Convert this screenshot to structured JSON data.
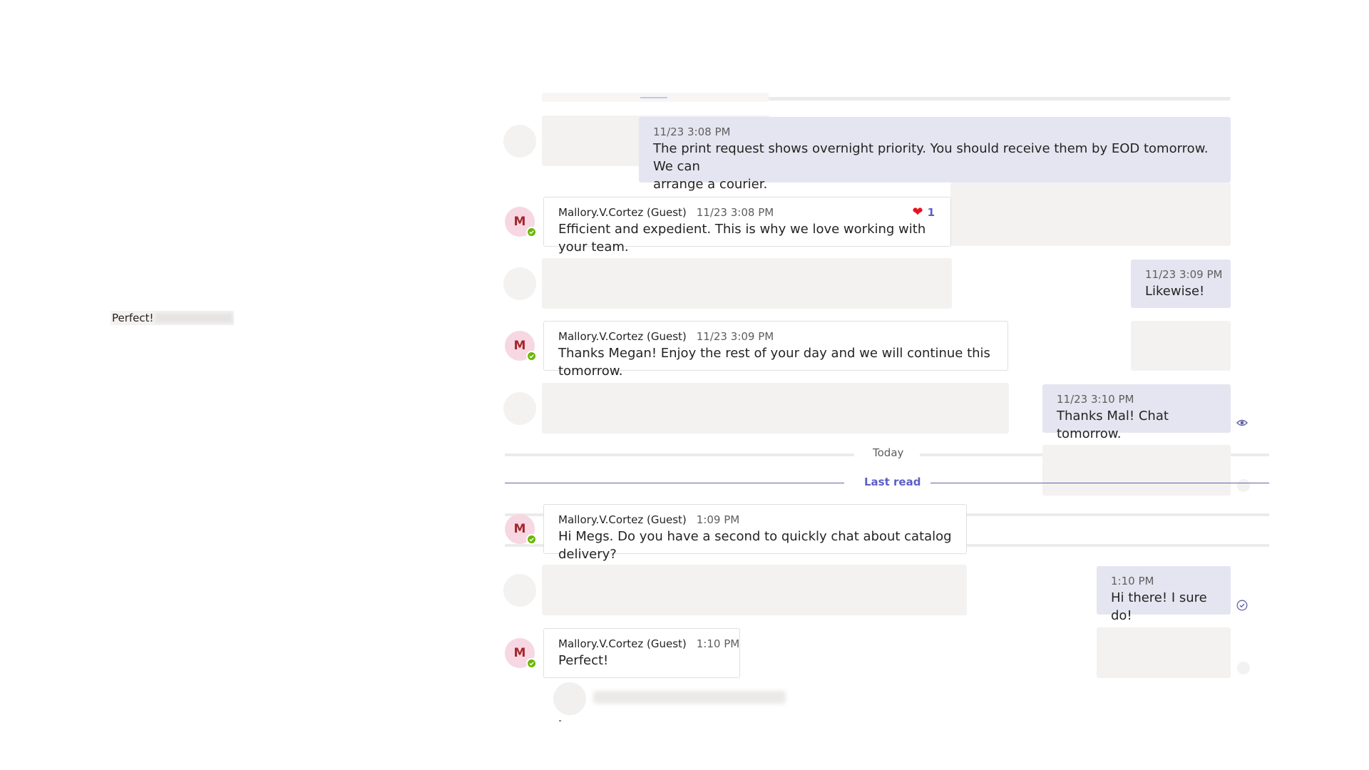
{
  "left_panel": {
    "preview_text": "Perfect!"
  },
  "messages": [
    {
      "direction": "outgoing",
      "timestamp": "11/23 3:08 PM",
      "text_line1": "The print request shows overnight priority. You should receive them by EOD tomorrow. We can",
      "text_line2": "arrange a courier."
    },
    {
      "direction": "incoming",
      "avatar_initial": "M",
      "author": "Mallory.V.Cortez (Guest)",
      "timestamp": "11/23 3:08 PM",
      "text": "Efficient and expedient. This is why we love working with your team.",
      "reaction": {
        "icon": "heart-icon",
        "count": "1"
      }
    },
    {
      "direction": "outgoing",
      "timestamp": "11/23 3:09 PM",
      "text": "Likewise!"
    },
    {
      "direction": "incoming",
      "avatar_initial": "M",
      "author": "Mallory.V.Cortez (Guest)",
      "timestamp": "11/23 3:09 PM",
      "text": "Thanks Megan! Enjoy the rest of your day and we will continue this tomorrow."
    },
    {
      "direction": "outgoing",
      "timestamp": "11/23 3:10 PM",
      "text": "Thanks Mal! Chat tomorrow.",
      "status_icon": "seen-eye-icon"
    },
    {
      "direction": "incoming",
      "avatar_initial": "M",
      "author": "Mallory.V.Cortez (Guest)",
      "timestamp": "1:09 PM",
      "text": "Hi Megs. Do you have a second to quickly chat about catalog delivery?"
    },
    {
      "direction": "outgoing",
      "timestamp": "1:10 PM",
      "text": "Hi there! I sure do!",
      "status_icon": "sent-check-icon"
    },
    {
      "direction": "incoming",
      "avatar_initial": "M",
      "author": "Mallory.V.Cortez (Guest)",
      "timestamp": "1:10 PM",
      "text": "Perfect!"
    }
  ],
  "dividers": {
    "today": "Today",
    "last_read": "Last read"
  },
  "colors": {
    "outgoing_bubble": "#e5e5f1",
    "accent": "#5b5fc7",
    "presence_available": "#6bb700",
    "avatar_bg": "#f6d7e2",
    "reaction_heart": "#e81123"
  }
}
